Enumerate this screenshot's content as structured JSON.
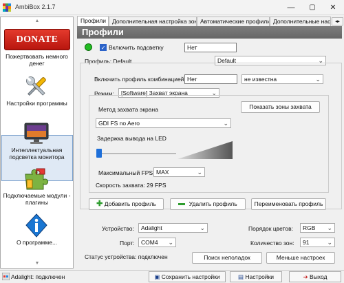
{
  "window": {
    "title": "AmbiBox 2.1.7",
    "minimize": "—",
    "maximize": "▢",
    "close": "✕"
  },
  "sidebar": {
    "donate_button": "DONATE NOW",
    "items": [
      {
        "label": "Пожертвовать немного денег"
      },
      {
        "label": "Настройки программы"
      },
      {
        "label": "Интеллектуальная подсветка монитора"
      },
      {
        "label": "Подключаемые модули - плагины"
      },
      {
        "label": "О программе..."
      }
    ]
  },
  "tabs": [
    {
      "label": "Профили"
    },
    {
      "label": "Дополнительная настройка зон"
    },
    {
      "label": "Автоматические профили"
    },
    {
      "label": "Дополнительные нас"
    }
  ],
  "panel": {
    "header": "Профили",
    "status_led_color": "#22bb22",
    "enable_backlight": {
      "label": "Включить подсветку",
      "checked": true
    },
    "backlight_value": "Нет",
    "profile_label": "Профиль: Default",
    "profile_select": "Default",
    "combo_profile_label": "Включить профиль комбинацией:",
    "combo_profile_value": "Нет",
    "combo_profile_key": "не известна",
    "mode_label": "Режим:",
    "mode_value": "[Software] Захват экрана",
    "show_zones_button": "Показать зоны захвата",
    "capture_method_label": "Метод захвата экрана",
    "capture_method_value": "GDI FS no Aero",
    "led_delay_label": "Задержка вывода на LED",
    "led_delay_level": 0.0,
    "max_fps_label": "Максимальный FPS",
    "max_fps_value": "MAX",
    "capture_speed": "Скорость захвата: 29 FPS",
    "add_profile_button": "Добавить профиль",
    "delete_profile_button": "Удалить профиль",
    "rename_profile_button": "Переименовать профиль",
    "device_label": "Устройство:",
    "device_value": "Adalight",
    "color_order_label": "Порядок цветов:",
    "color_order_value": "RGB",
    "port_label": "Порт:",
    "port_value": "COM4",
    "zones_label": "Количество зон:",
    "zones_value": "91",
    "device_status": "Статус устройства: подключен",
    "search_faults_button": "Поиск неполадок",
    "fewer_settings_button": "Меньше настроек"
  },
  "statusbar": {
    "connection": "Adalight: подключен",
    "save_settings": "Сохранить настройки",
    "settings": "Настройки",
    "exit": "Выход"
  }
}
